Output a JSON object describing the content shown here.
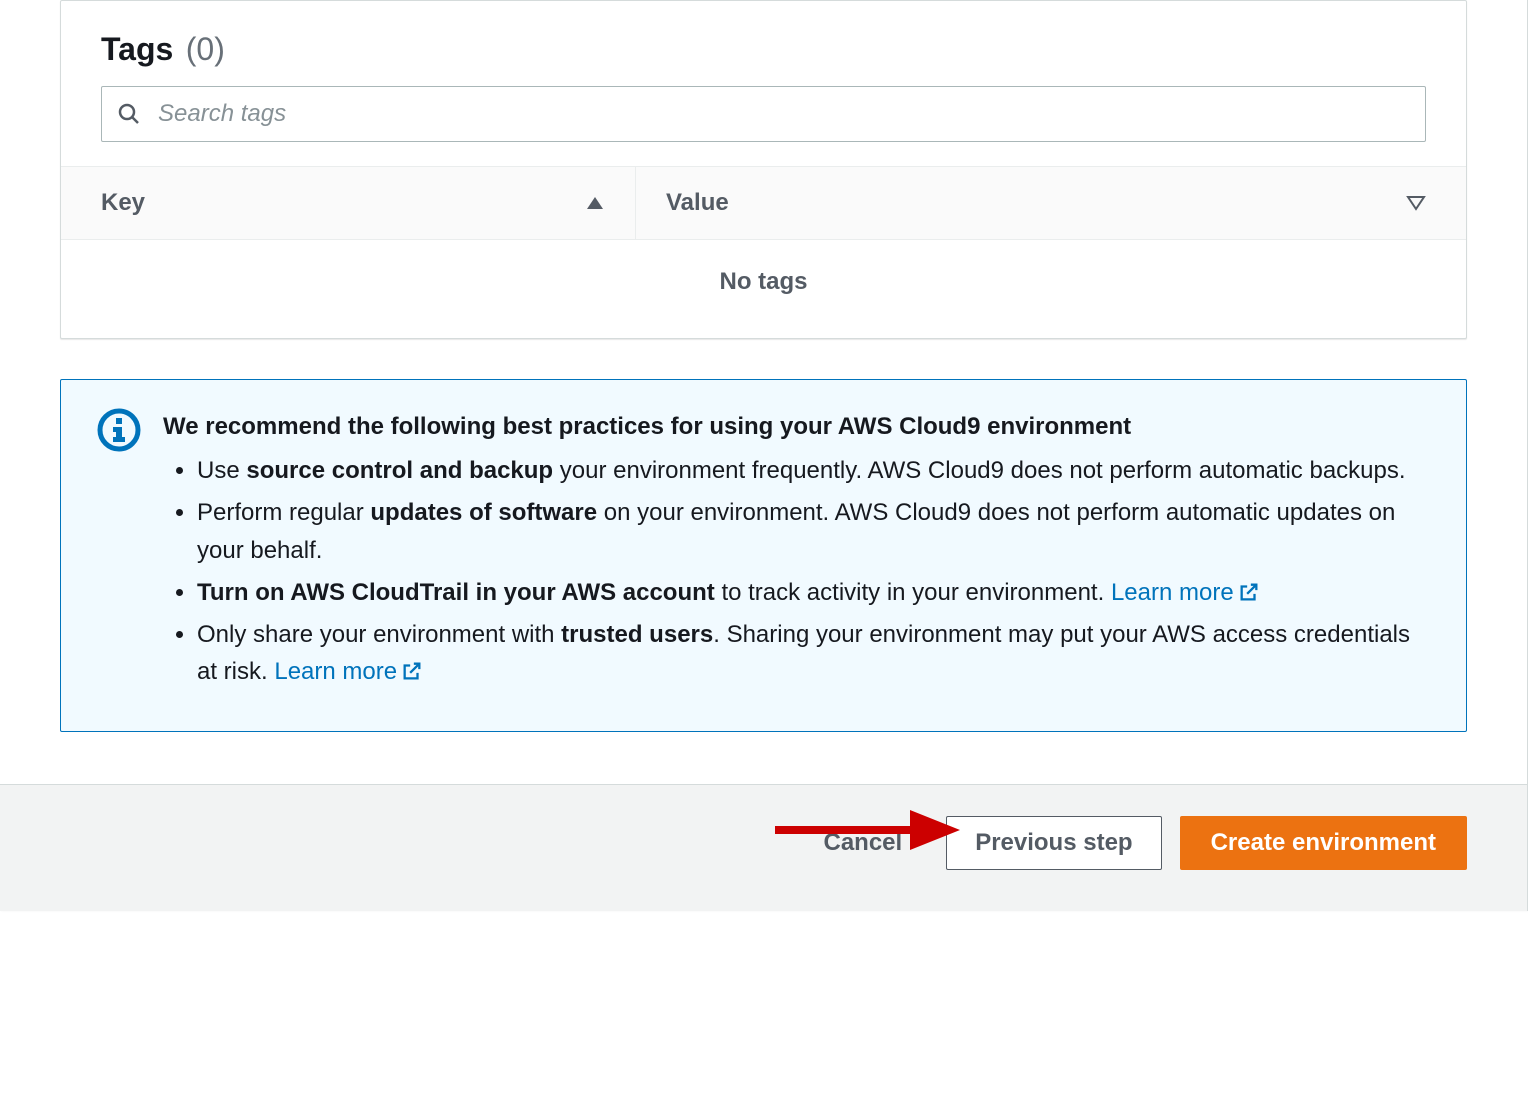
{
  "tagsPanel": {
    "titleLabel": "Tags",
    "countLabel": "(0)",
    "searchPlaceholder": "Search tags",
    "columns": {
      "key": "Key",
      "value": "Value"
    },
    "emptyText": "No tags"
  },
  "infoBox": {
    "title": "We recommend the following best practices for using your AWS Cloud9 environment",
    "items": [
      {
        "prefix": "Use ",
        "bold1": "source control and backup",
        "rest": " your environment frequently. AWS Cloud9 does not perform automatic backups."
      },
      {
        "prefix": "Perform regular ",
        "bold1": "updates of software",
        "rest": " on your environment. AWS Cloud9 does not perform automatic updates on your behalf."
      },
      {
        "bold1": "Turn on AWS CloudTrail in your AWS account",
        "rest": " to track activity in your environment. ",
        "linkText": "Learn more"
      },
      {
        "prefix": "Only share your environment with ",
        "bold1": "trusted users",
        "rest": ". Sharing your environment may put your AWS access credentials at risk. ",
        "linkText": "Learn more"
      }
    ]
  },
  "footer": {
    "cancelLabel": "Cancel",
    "previousLabel": "Previous step",
    "createLabel": "Create environment"
  }
}
